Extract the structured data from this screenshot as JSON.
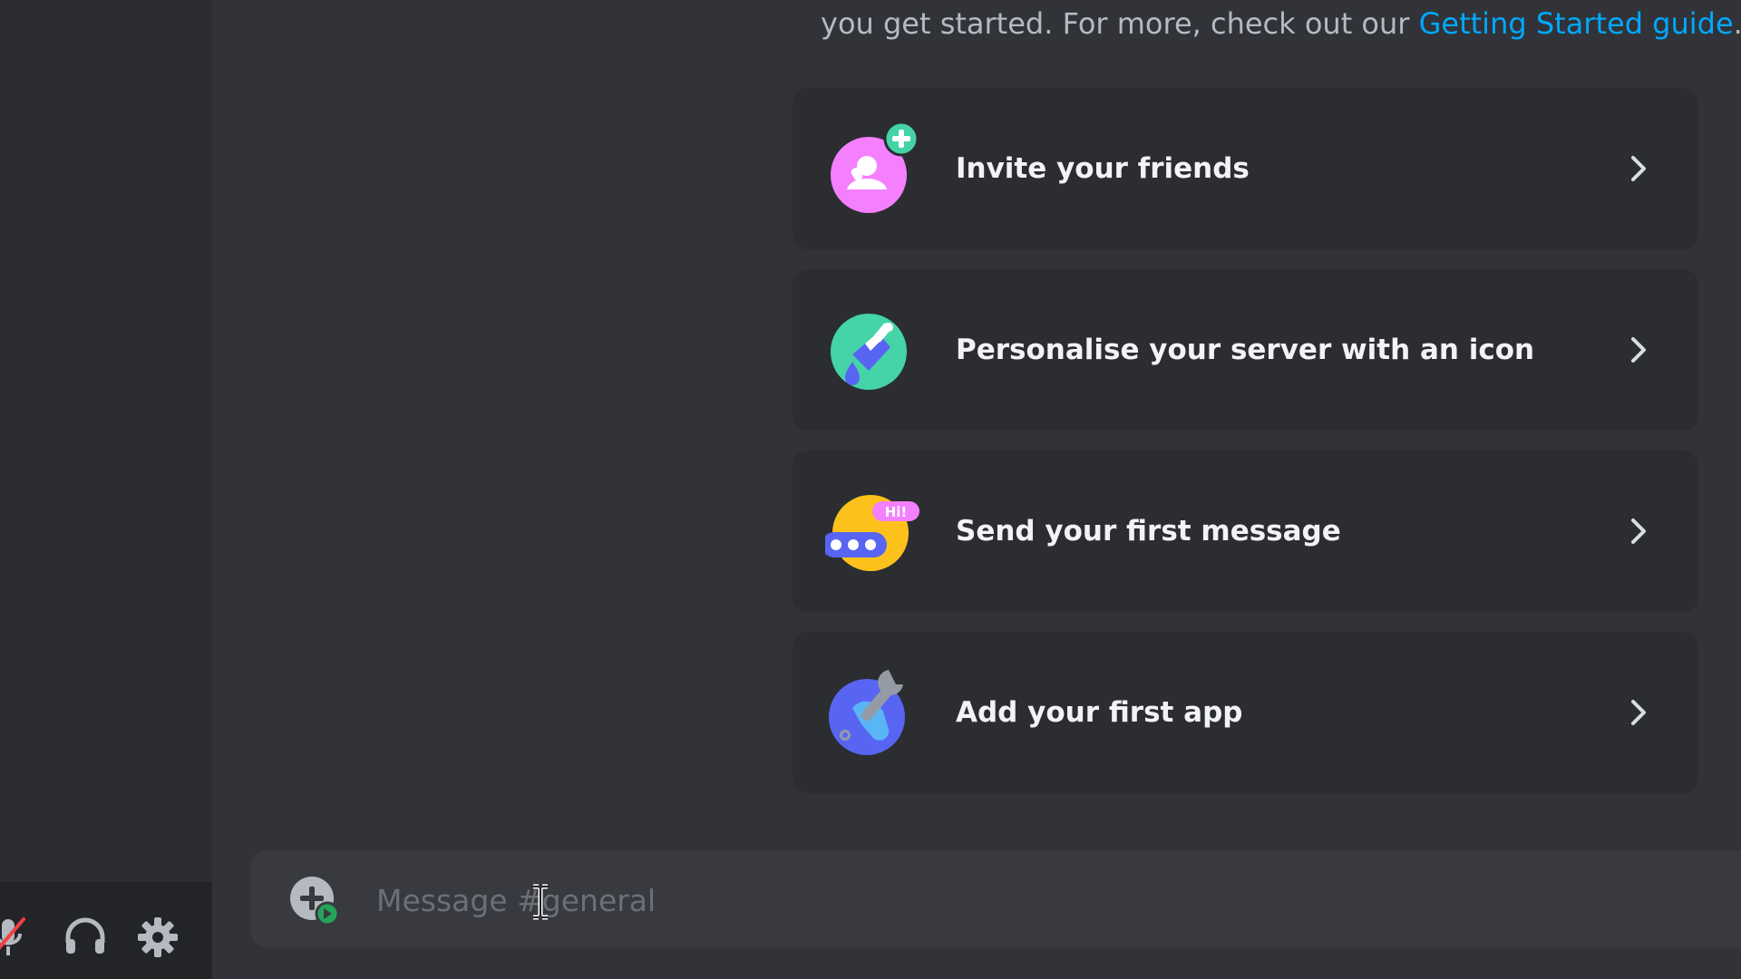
{
  "intro": {
    "text": "you get started. For more, check out our ",
    "link": "Getting Started guide",
    "period": "."
  },
  "cards": [
    {
      "label": "Invite your friends",
      "icon": "invite-friends-icon"
    },
    {
      "label": "Personalise your server with an icon",
      "icon": "paintbrush-icon"
    },
    {
      "label": "Send your first message",
      "icon": "chat-bubble-icon",
      "badge": "Hi!"
    },
    {
      "label": "Add your first app",
      "icon": "wrench-app-icon"
    }
  ],
  "composer": {
    "placeholder": "Message #general"
  },
  "user_panel": {
    "icons": [
      "microphone-muted-icon",
      "headphones-icon",
      "settings-gear-icon"
    ]
  },
  "colors": {
    "background": "#313338",
    "sidebar": "#2b2d31",
    "card": "#2b2d31",
    "link": "#00a8fc",
    "invite_pink": "#f47fff",
    "brush_teal": "#45d3a8",
    "message_yellow": "#fcc21b",
    "app_blue": "#5865f2",
    "muted_red": "#f23f43",
    "online_green": "#23a55a"
  }
}
